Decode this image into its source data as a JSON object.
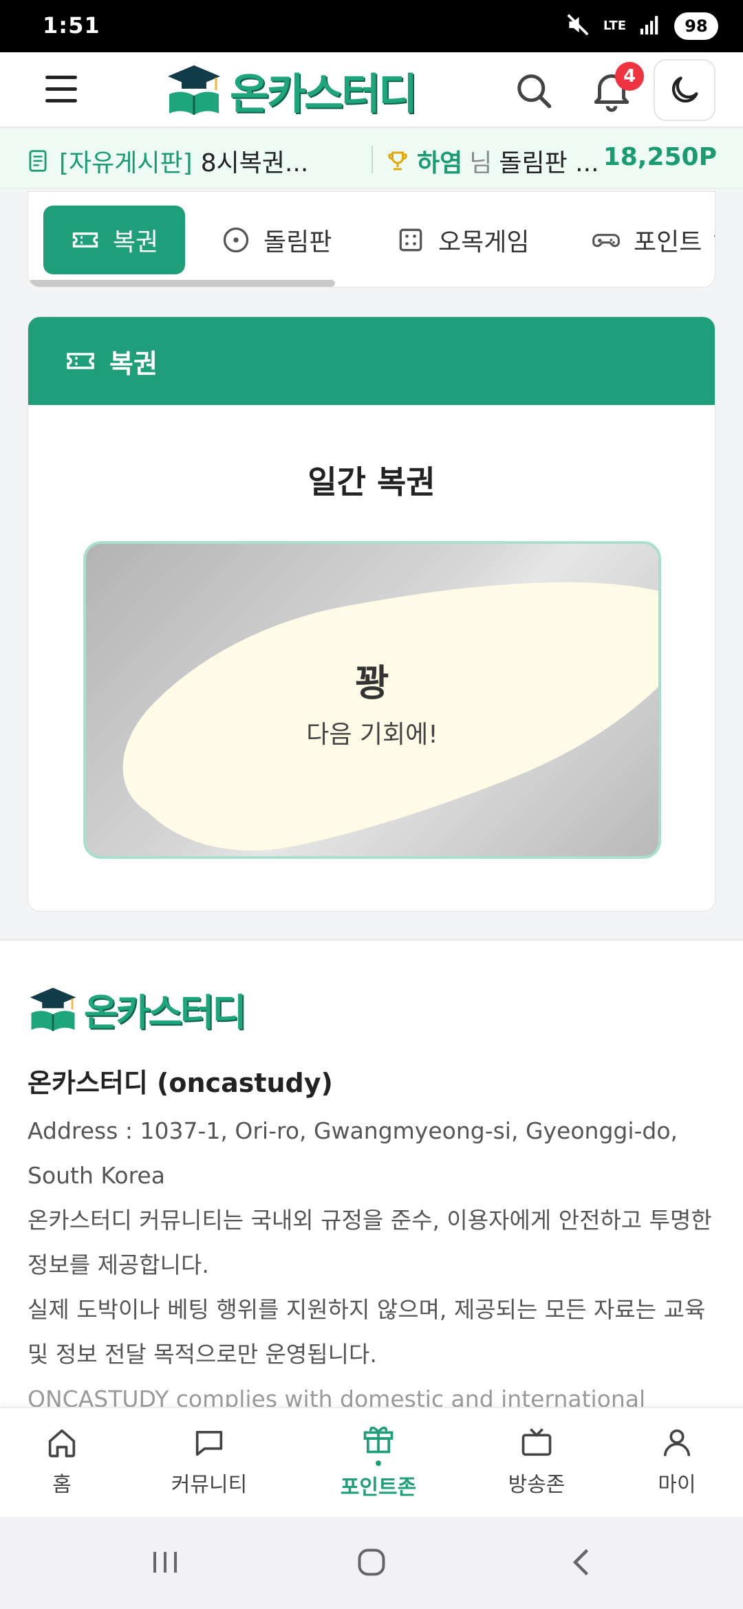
{
  "status_bar": {
    "time": "1:51",
    "network": "LTE",
    "battery": "98"
  },
  "header": {
    "logo_text": "온카스터디",
    "notification_count": "4",
    "icons": [
      "menu-icon",
      "search-icon",
      "bell-icon",
      "moon-icon"
    ]
  },
  "ticker": {
    "board": "[자유게시판]",
    "post": "8시복권...",
    "user": "하염",
    "honorific": "님",
    "activity": "돌림판 ...",
    "points": "18,250P"
  },
  "tabs": [
    {
      "label": "복권",
      "icon": "ticket-icon",
      "active": true
    },
    {
      "label": "돌림판",
      "icon": "wheel-icon",
      "active": false
    },
    {
      "label": "오목게임",
      "icon": "dice-icon",
      "active": false
    },
    {
      "label": "포인트 ㄱ",
      "icon": "gamepad-icon",
      "active": false
    }
  ],
  "lotto": {
    "header": "복권",
    "title": "일간 복권",
    "result": "꽝",
    "message": "다음 기회에!"
  },
  "footer": {
    "logo_text": "온카스터디",
    "name": "온카스터디 (oncastudy)",
    "address": "Address : 1037-1, Ori-ro, Gwangmyeong-si, Gyeonggi-do, South Korea",
    "notice1": "온카스터디 커뮤니티는 국내외 규정을 준수, 이용자에게 안전하고 투명한 정보를 제공합니다.",
    "notice2": "실제 도박이나 베팅 행위를 지원하지 않으며, 제공되는 모든 자료는 교육 및 정보 전달 목적으로만 운영됩니다.",
    "notice_en": "ONCASTUDY complies with domestic and international"
  },
  "bottom_nav": [
    {
      "label": "홈",
      "icon": "home-icon",
      "active": false
    },
    {
      "label": "커뮤니티",
      "icon": "chat-icon",
      "active": false
    },
    {
      "label": "포인트존",
      "icon": "gift-icon",
      "active": true
    },
    {
      "label": "방송존",
      "icon": "tv-icon",
      "active": false
    },
    {
      "label": "마이",
      "icon": "user-icon",
      "active": false
    }
  ],
  "colors": {
    "accent": "#1f9f79",
    "badge": "#ef3340",
    "ticker_bg": "#eefaf4"
  }
}
